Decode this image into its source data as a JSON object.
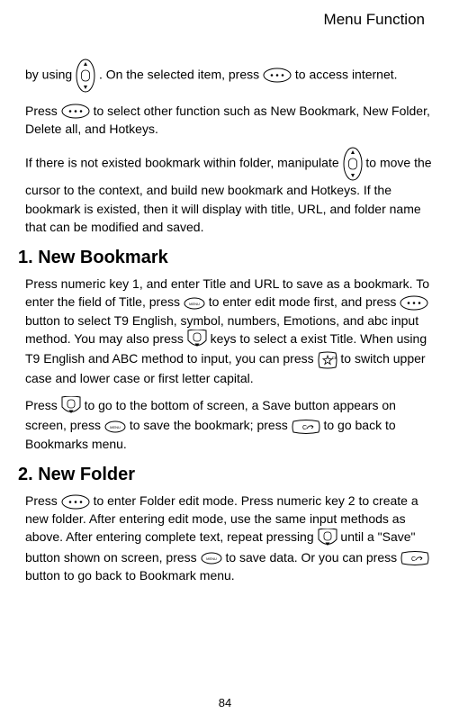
{
  "header": {
    "title": "Menu Function"
  },
  "intro": {
    "p1a": "by using ",
    "p1b": ".   On the selected item, press ",
    "p1c": " to access internet.",
    "p2a": "Press ",
    "p2b": " to select other function such as New Bookmark, New Folder, Delete all, and Hotkeys.",
    "p3a": "If there is not existed bookmark within folder, manipulate ",
    "p3b": " to move the cursor to the context, and build new bookmark and Hotkeys.    If the bookmark is existed, then it will display with title, URL, and folder name that can be modified and saved."
  },
  "section1": {
    "heading": "1. New Bookmark",
    "p1a": "Press numeric key 1, and enter Title and URL to save as a bookmark. To enter the field of Title, press ",
    "p1b": "to enter edit mode first, and press",
    "p1c": " button to select T9 English, symbol, numbers, Emotions, and abc input method. You may also press ",
    "p1d": "keys to select a exist Title.    When using T9 English and ABC method to input, you can press ",
    "p1e": " to switch upper case and lower case or first letter capital.",
    "p2a": "Press",
    "p2b": "to go to the bottom of screen, a Save button appears on screen, press ",
    "p2c": "to save the bookmark; press ",
    "p2d": " to go back to Bookmarks menu."
  },
  "section2": {
    "heading": "2. New Folder",
    "p1a": "Press ",
    "p1b": " to enter Folder edit mode. Press numeric key 2 to create a new folder.    After entering edit mode, use the same input methods as above. After entering complete text, repeat pressing",
    "p1c": "until a \"Save\" button shown on screen, press ",
    "p1d": "to save data. Or you can press ",
    "p1e": "button to go back to Bookmark menu."
  },
  "page_number": "84"
}
